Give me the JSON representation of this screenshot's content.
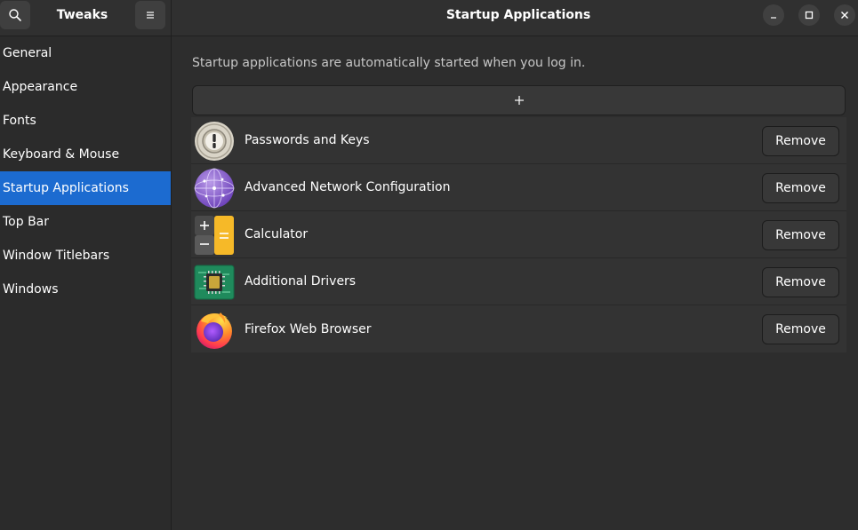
{
  "header": {
    "sidebar_title": "Tweaks",
    "main_title": "Startup Applications",
    "search_icon": "search-icon",
    "menu_icon": "hamburger-menu-icon",
    "window_controls": [
      "minimize-icon",
      "maximize-icon",
      "close-icon"
    ]
  },
  "sidebar": {
    "items": [
      {
        "label": "General"
      },
      {
        "label": "Appearance"
      },
      {
        "label": "Fonts"
      },
      {
        "label": "Keyboard & Mouse"
      },
      {
        "label": "Startup Applications",
        "active": true
      },
      {
        "label": "Top Bar"
      },
      {
        "label": "Window Titlebars"
      },
      {
        "label": "Windows"
      }
    ]
  },
  "main": {
    "description": "Startup applications are automatically started when you log in.",
    "add_icon": "plus-icon",
    "apps": [
      {
        "name": "Passwords and Keys",
        "icon": "keyring-icon",
        "remove_label": "Remove"
      },
      {
        "name": "Advanced Network Configuration",
        "icon": "network-globe-icon",
        "remove_label": "Remove"
      },
      {
        "name": "Calculator",
        "icon": "calculator-icon",
        "remove_label": "Remove"
      },
      {
        "name": "Additional Drivers",
        "icon": "chip-icon",
        "remove_label": "Remove"
      },
      {
        "name": "Firefox Web Browser",
        "icon": "firefox-icon",
        "remove_label": "Remove"
      }
    ]
  },
  "colors": {
    "accent": "#1c6bd0",
    "background": "#2d2d2d",
    "sidebar": "#2b2b2b",
    "list_row": "#333333",
    "button": "#383838"
  }
}
